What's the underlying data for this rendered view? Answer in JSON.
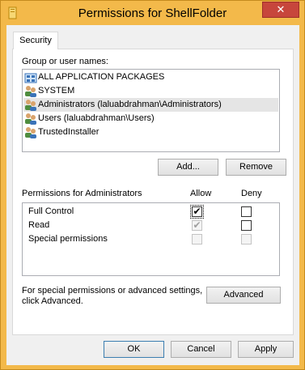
{
  "window": {
    "title": "Permissions for ShellFolder",
    "close_glyph": "✕"
  },
  "tabs": [
    {
      "label": "Security"
    }
  ],
  "group_section": {
    "label": "Group or user names:",
    "items": [
      {
        "name": "ALL APPLICATION PACKAGES",
        "icon": "packages-icon",
        "selected": false
      },
      {
        "name": "SYSTEM",
        "icon": "users-icon",
        "selected": false
      },
      {
        "name": "Administrators (laluabdrahman\\Administrators)",
        "icon": "users-icon",
        "selected": true
      },
      {
        "name": "Users (laluabdrahman\\Users)",
        "icon": "users-icon",
        "selected": false
      },
      {
        "name": "TrustedInstaller",
        "icon": "users-icon",
        "selected": false
      }
    ],
    "add_label": "Add...",
    "remove_label": "Remove"
  },
  "permissions": {
    "label": "Permissions for Administrators",
    "allow_header": "Allow",
    "deny_header": "Deny",
    "rows": [
      {
        "name": "Full Control",
        "allow": true,
        "allow_enabled": true,
        "deny": false,
        "deny_enabled": true
      },
      {
        "name": "Read",
        "allow": true,
        "allow_enabled": false,
        "deny": false,
        "deny_enabled": true
      },
      {
        "name": "Special permissions",
        "allow": false,
        "allow_enabled": false,
        "deny": false,
        "deny_enabled": false
      }
    ],
    "check_glyph": "✔"
  },
  "advanced_section": {
    "text_line1": "For special permissions or advanced settings,",
    "text_line2": "click Advanced.",
    "advanced_label": "Advanced"
  },
  "footer": {
    "ok_label": "OK",
    "cancel_label": "Cancel",
    "apply_label": "Apply"
  },
  "colors": {
    "frame": "#f3b94a",
    "close": "#c7463c",
    "selection": "#e5e5e5"
  }
}
